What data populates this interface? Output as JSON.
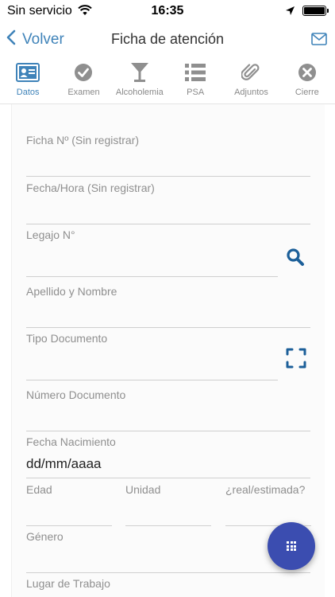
{
  "status_bar": {
    "carrier": "Sin servicio",
    "time": "16:35"
  },
  "nav": {
    "back_label": "Volver",
    "title": "Ficha de atención"
  },
  "tabs": [
    {
      "label": "Datos",
      "icon": "id-card-icon"
    },
    {
      "label": "Examen",
      "icon": "check-circle-icon"
    },
    {
      "label": "Alcoholemia",
      "icon": "cocktail-glass-icon"
    },
    {
      "label": "PSA",
      "icon": "list-icon"
    },
    {
      "label": "Adjuntos",
      "icon": "paperclip-icon"
    },
    {
      "label": "Cierre",
      "icon": "close-circle-icon"
    }
  ],
  "form": {
    "ficha_label": "Ficha Nº (Sin registrar)",
    "fecha_hora_label": "Fecha/Hora (Sin registrar)",
    "legajo_label": "Legajo N°",
    "apellido_label": "Apellido y Nombre",
    "tipo_doc_label": "Tipo Documento",
    "numero_doc_label": "Número Documento",
    "fecha_nac_label": "Fecha Nacimiento",
    "fecha_nac_value": "dd/mm/aaaa",
    "edad_label": "Edad",
    "unidad_label": "Unidad",
    "real_estimada_label": "¿real/estimada?",
    "genero_label": "Género",
    "lugar_trabajo_label": "Lugar de Trabajo"
  },
  "colors": {
    "accent": "#3f83b9",
    "fab": "#3b4db0",
    "search_icon": "#1c5f99"
  }
}
